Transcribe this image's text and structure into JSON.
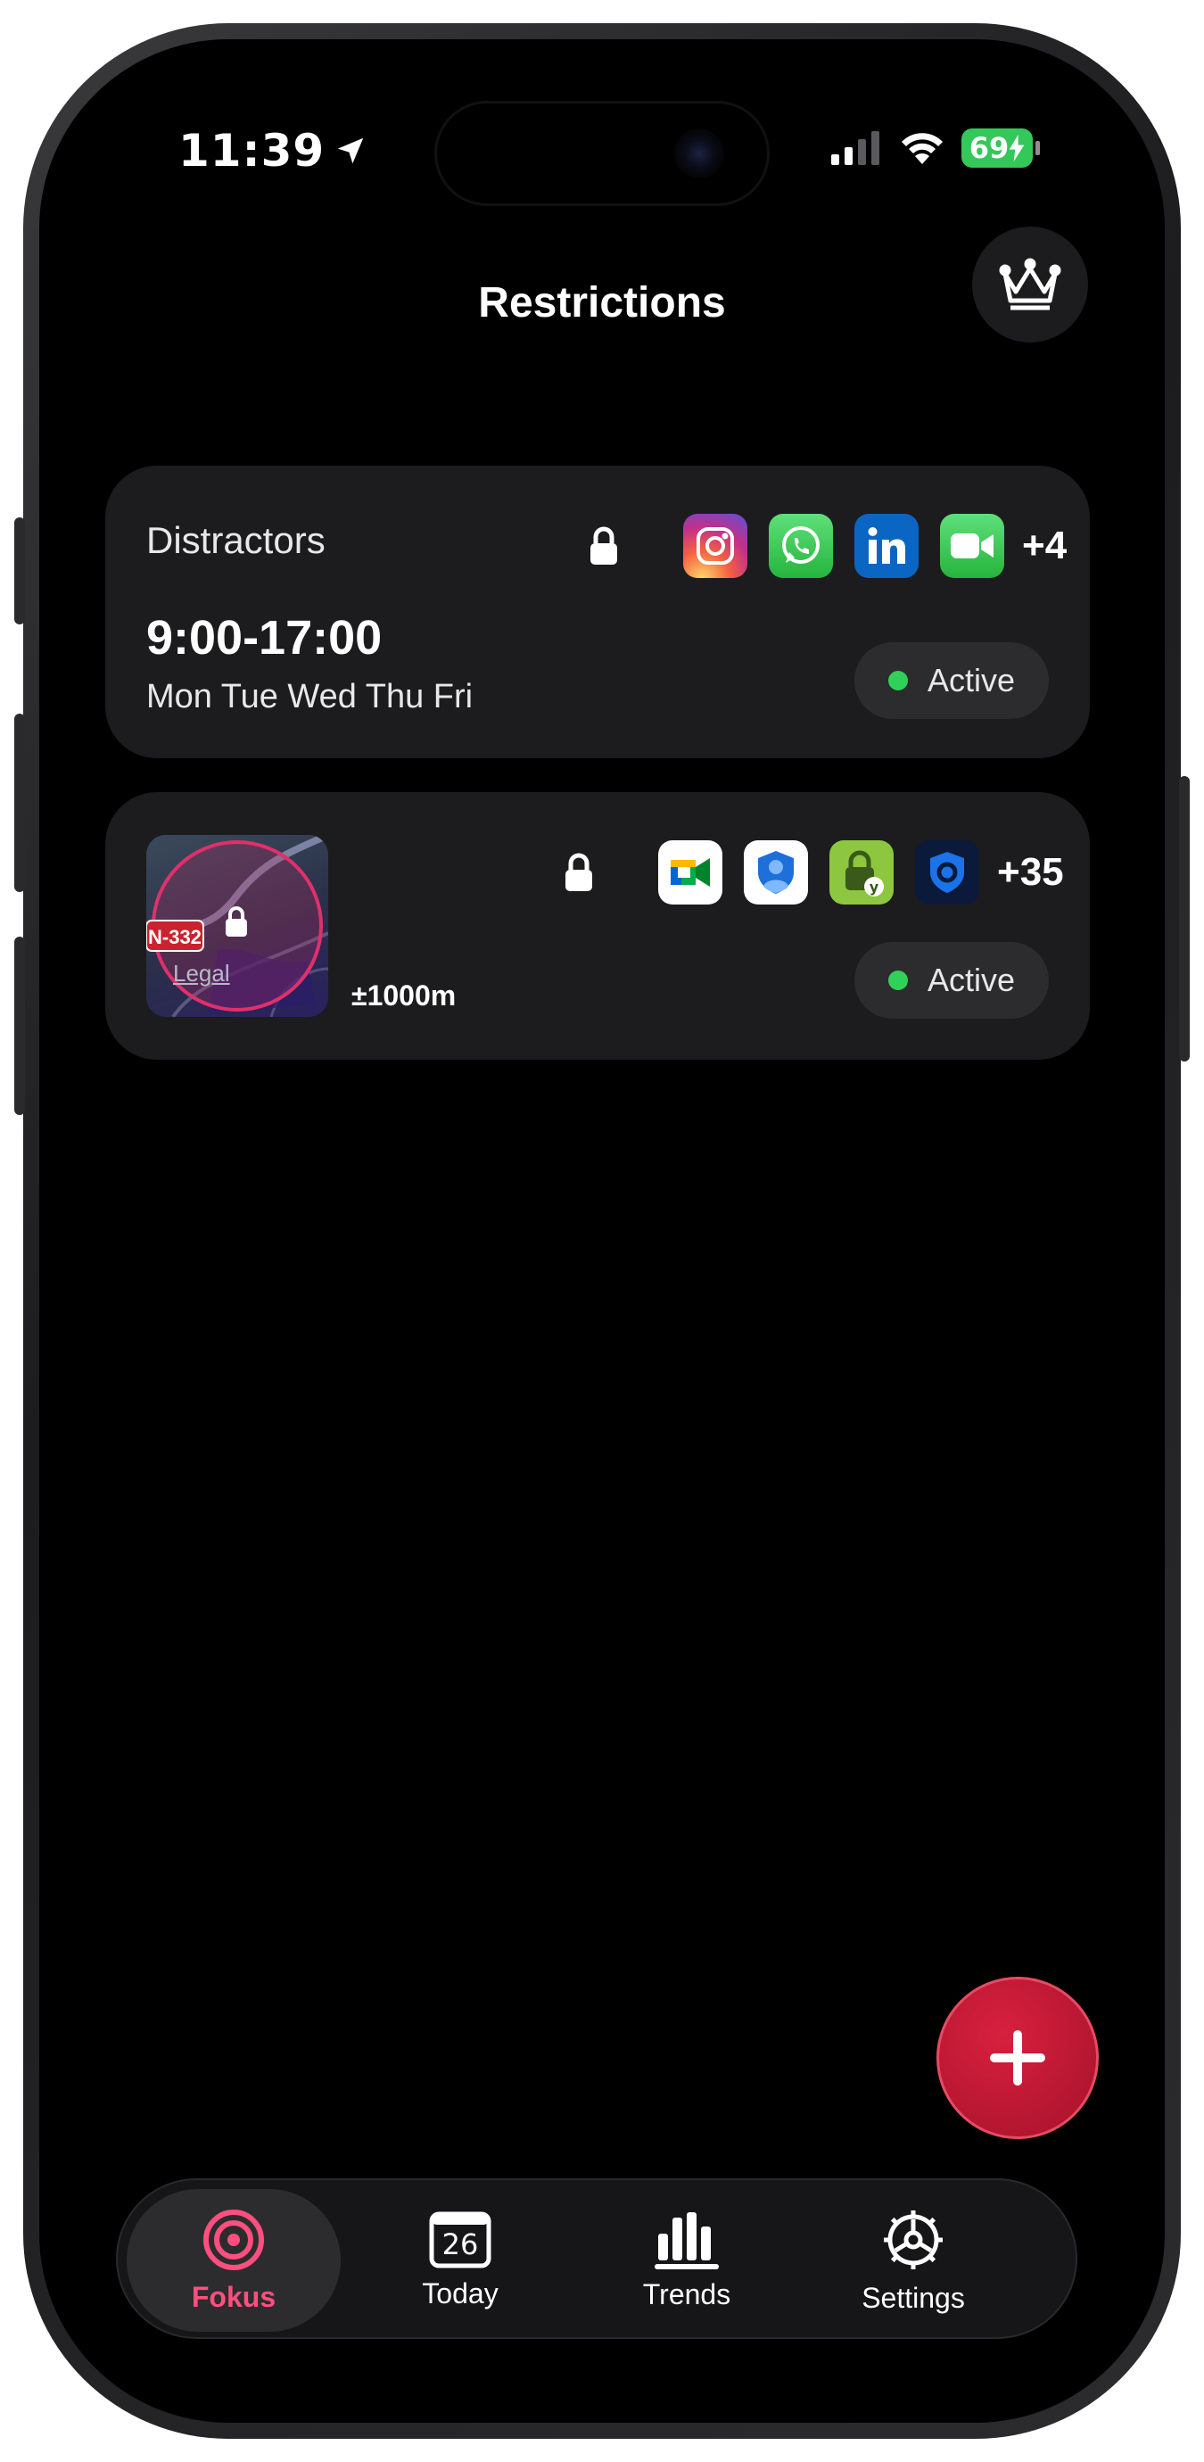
{
  "status_bar": {
    "time": "11:39",
    "battery": "69",
    "icons": [
      "location-arrow-icon",
      "cellular-signal-icon",
      "wifi-icon",
      "battery-charging-icon"
    ]
  },
  "header": {
    "title": "Restrictions",
    "premium_icon": "crown-icon"
  },
  "restrictions": [
    {
      "title": "Distractors",
      "time_range": "9:00-17:00",
      "days": "Mon Tue Wed Thu Fri",
      "apps": [
        "instagram-app-icon",
        "whatsapp-app-icon",
        "linkedin-app-icon",
        "facetime-app-icon"
      ],
      "more_count": "+4",
      "status": "Active"
    },
    {
      "map": {
        "road_label": "N-332",
        "legal_label": "Legal"
      },
      "radius": "±1000m",
      "apps": [
        "google-meet-app-icon",
        "authenticator-app-icon",
        "vpn-lock-app-icon",
        "shield-app-icon"
      ],
      "more_count": "+35",
      "status": "Active"
    }
  ],
  "fab": {
    "icon": "plus-icon"
  },
  "tabbar": {
    "tabs": [
      {
        "label": "Fokus",
        "icon": "target-icon",
        "active": true
      },
      {
        "label": "Today",
        "icon": "calendar-icon",
        "badge": "26",
        "active": false
      },
      {
        "label": "Trends",
        "icon": "bar-chart-icon",
        "active": false
      },
      {
        "label": "Settings",
        "icon": "gear-icon",
        "active": false
      }
    ]
  },
  "colors": {
    "accent": "#ff4f7e",
    "active_dot": "#30d158",
    "fab": "#c8193a",
    "card": "#1c1c1e"
  }
}
